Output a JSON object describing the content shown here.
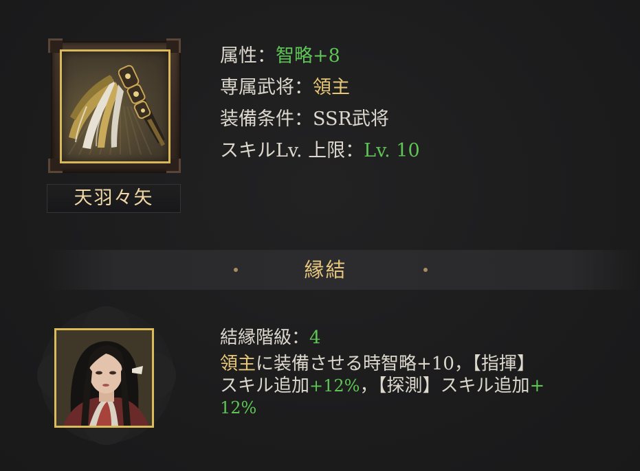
{
  "item": {
    "name": "天羽々矢",
    "icon": "tasseled-whisk-weapon-icon"
  },
  "stats": {
    "attribute_label": "属性：",
    "attribute_value": "智略+8",
    "exclusive_label": "専属武将：",
    "exclusive_value": "領主",
    "equip_label": "装備条件：",
    "equip_value": "SSR武将",
    "skill_label": "スキルLv. 上限：",
    "skill_value": "Lv. 10"
  },
  "section": {
    "title": "縁結"
  },
  "bond": {
    "rank_label": "結縁階級：",
    "rank_value": "4",
    "line1_lord": "領主",
    "line1_text": "に装備させる時智略+10，【指揮】",
    "line2_a": "スキル追加",
    "line2_b": "+12%",
    "line2_c": "，【探測】スキル追加",
    "line2_d": "+",
    "line3": "12%",
    "portrait": "lord-portrait"
  },
  "colors": {
    "green": "#5ec455",
    "gold": "#e9c778",
    "text": "#ddd8cd",
    "frame_gold": "#dcbb5b",
    "background": "#1c1c1d"
  }
}
